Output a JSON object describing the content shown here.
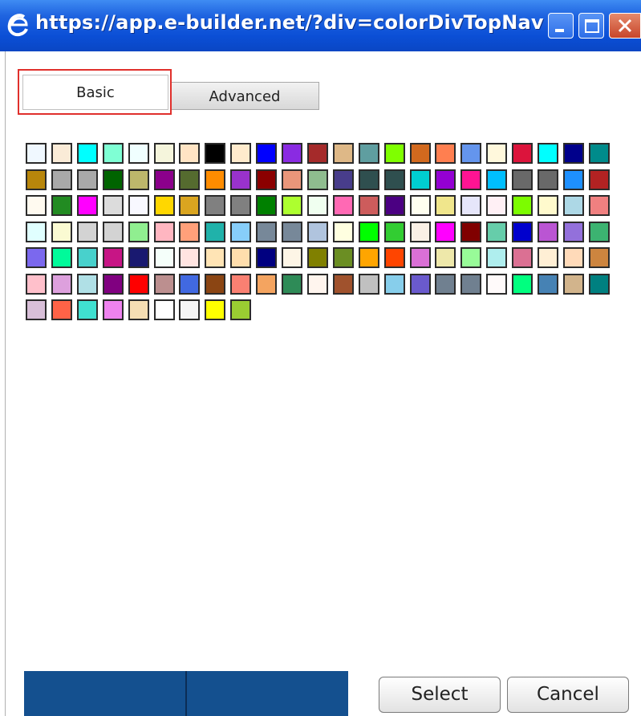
{
  "window": {
    "title": "https://app.e-builder.net/?div=colorDivTopNav ..."
  },
  "tabs": [
    {
      "label": "Basic",
      "selected": true
    },
    {
      "label": "Advanced",
      "selected": false
    }
  ],
  "palette": {
    "colors": [
      "#f0f8ff",
      "#faebd7",
      "#00ffff",
      "#7fffd4",
      "#f0ffff",
      "#f5f5dc",
      "#ffe4c4",
      "#000000",
      "#ffebcd",
      "#0000ff",
      "#8a2be2",
      "#a52a2a",
      "#deb887",
      "#5f9ea0",
      "#7fff00",
      "#d2691e",
      "#ff7f50",
      "#6495ed",
      "#fff8dc",
      "#dc143c",
      "#00ffff",
      "#00008b",
      "#008b8b",
      "#b8860b",
      "#a9a9a9",
      "#a9a9a9",
      "#006400",
      "#bdb76b",
      "#8b008b",
      "#556b2f",
      "#ff8c00",
      "#9932cc",
      "#8b0000",
      "#e9967a",
      "#8fbc8f",
      "#483d8b",
      "#2f4f4f",
      "#2f4f4f",
      "#00ced1",
      "#9400d3",
      "#ff1493",
      "#00bfff",
      "#696969",
      "#696969",
      "#1e90ff",
      "#b22222",
      "#fffaf0",
      "#228b22",
      "#ff00ff",
      "#dcdcdc",
      "#f8f8ff",
      "#ffd700",
      "#daa520",
      "#808080",
      "#808080",
      "#008000",
      "#adff2f",
      "#f0fff0",
      "#ff69b4",
      "#cd5c5c",
      "#4b0082",
      "#fffff0",
      "#f0e68c",
      "#e6e6fa",
      "#fff0f5",
      "#7cfc00",
      "#fffacd",
      "#add8e6",
      "#f08080",
      "#e0ffff",
      "#fafad2",
      "#d3d3d3",
      "#d3d3d3",
      "#90ee90",
      "#ffb6c1",
      "#ffa07a",
      "#20b2aa",
      "#87cefa",
      "#778899",
      "#778899",
      "#b0c4de",
      "#ffffe0",
      "#00ff00",
      "#32cd32",
      "#faf0e6",
      "#ff00ff",
      "#800000",
      "#66cdaa",
      "#0000cd",
      "#ba55d3",
      "#9370db",
      "#3cb371",
      "#7b68ee",
      "#00fa9a",
      "#48d1cc",
      "#c71585",
      "#191970",
      "#f5fffa",
      "#ffe4e1",
      "#ffe4b5",
      "#ffdead",
      "#000080",
      "#fdf5e6",
      "#808000",
      "#6b8e23",
      "#ffa500",
      "#ff4500",
      "#da70d6",
      "#eee8aa",
      "#98fb98",
      "#afeeee",
      "#db7093",
      "#ffefd5",
      "#ffdab9",
      "#cd853f",
      "#ffc0cb",
      "#dda0dd",
      "#b0e0e6",
      "#800080",
      "#ff0000",
      "#bc8f8f",
      "#4169e1",
      "#8b4513",
      "#fa8072",
      "#f4a460",
      "#2e8b57",
      "#fff5ee",
      "#a0522d",
      "#c0c0c0",
      "#87ceeb",
      "#6a5acd",
      "#708090",
      "#708090",
      "#fffafa",
      "#00ff7f",
      "#4682b4",
      "#d2b48c",
      "#008080",
      "#d8bfd8",
      "#ff6347",
      "#40e0d0",
      "#ee82ee",
      "#f5deb3",
      "#ffffff",
      "#f5f5f5",
      "#ffff00",
      "#9acd32"
    ]
  },
  "buttons": {
    "select_label": "Select",
    "cancel_label": "Cancel"
  }
}
